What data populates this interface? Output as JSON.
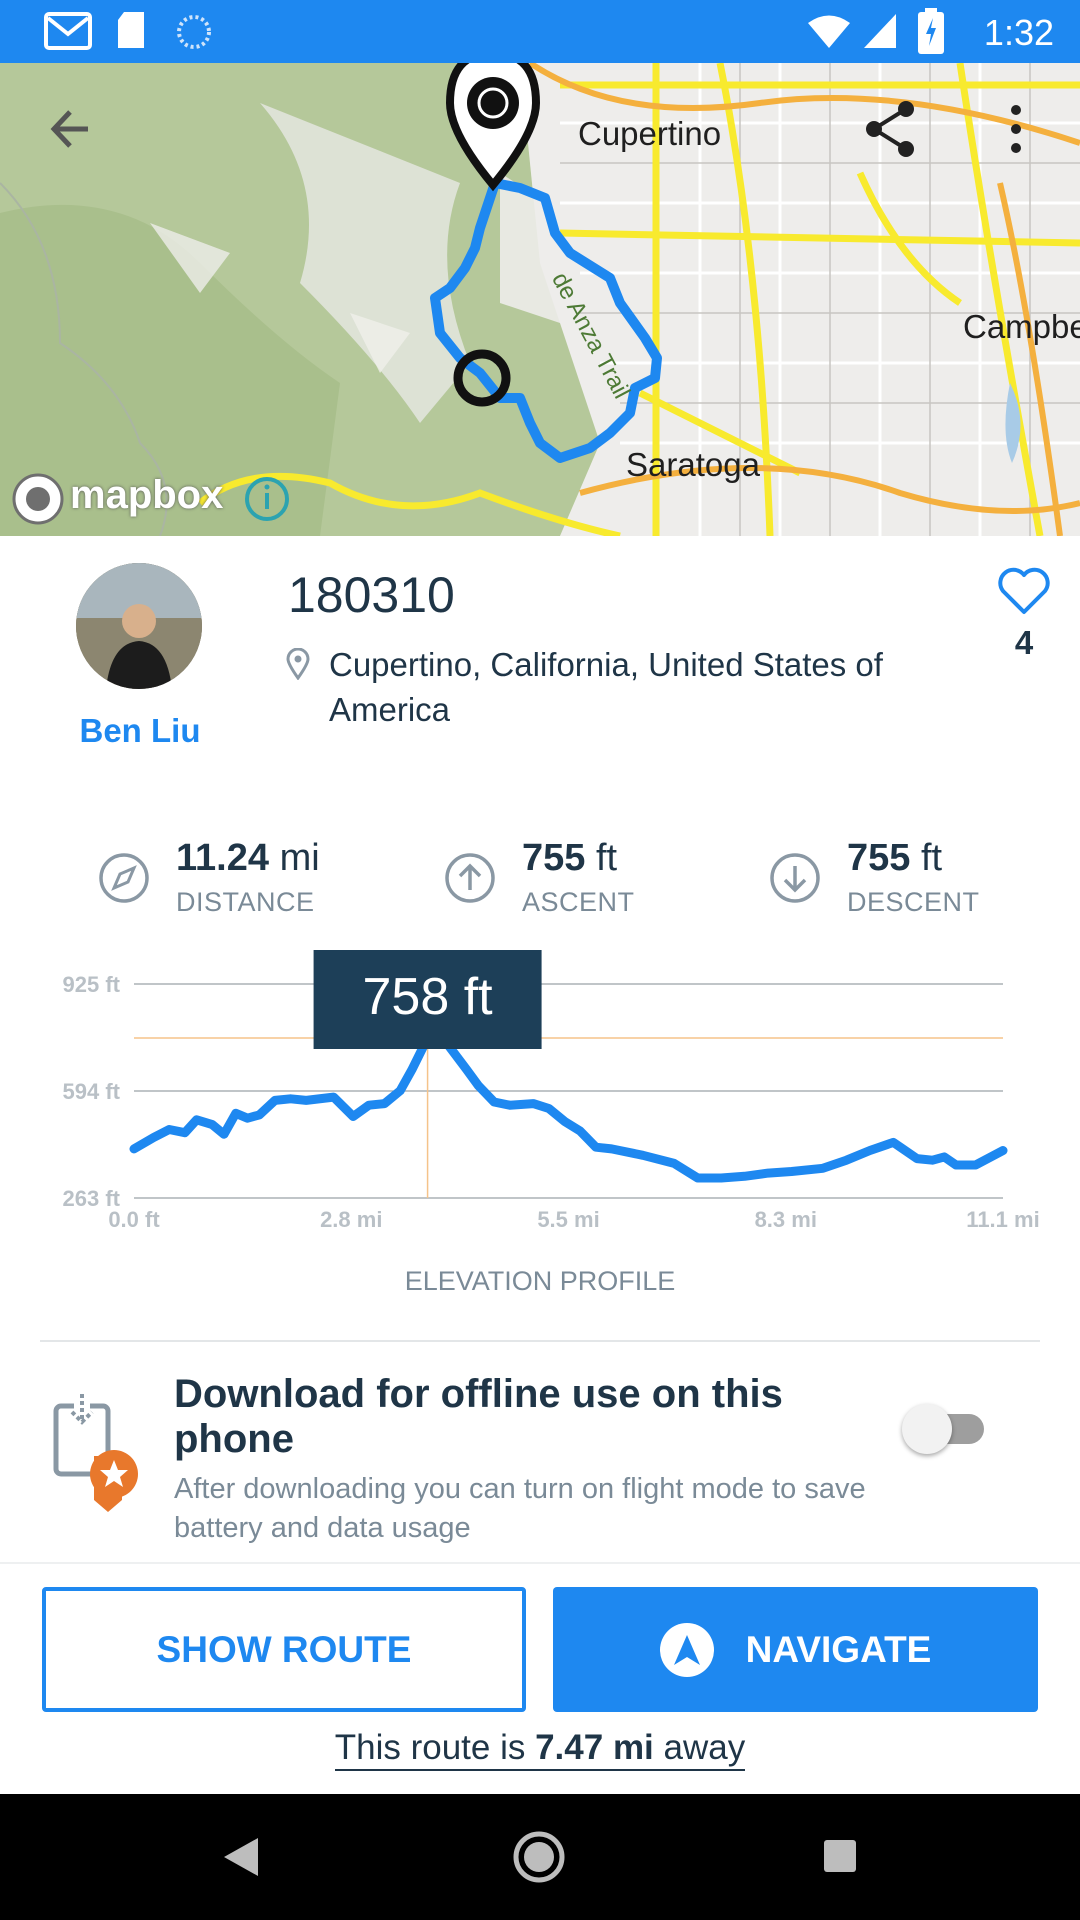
{
  "status_bar": {
    "time": "1:32"
  },
  "map": {
    "labels": {
      "cupertino": "Cupertino",
      "saratoga": "Saratoga",
      "campbell": "Campbe",
      "trail": "de Anza Trail"
    },
    "attribution": "mapbox"
  },
  "route": {
    "title": "180310",
    "location": "Cupertino, California, United States of America",
    "author": "Ben Liu",
    "likes": "4"
  },
  "stats": {
    "distance": {
      "value": "11.24",
      "unit": "mi",
      "label": "DISTANCE"
    },
    "ascent": {
      "value": "755",
      "unit": "ft",
      "label": "ASCENT"
    },
    "descent": {
      "value": "755",
      "unit": "ft",
      "label": "DESCENT"
    }
  },
  "chart_data": {
    "type": "line",
    "title": "ELEVATION PROFILE",
    "y_ticks": [
      "925 ft",
      "594 ft",
      "263 ft"
    ],
    "x_ticks": [
      "0.0 ft",
      "2.8 mi",
      "5.5 mi",
      "8.3 mi",
      "11.1 mi"
    ],
    "ylim": [
      263,
      925
    ],
    "xlim": [
      0,
      11.1
    ],
    "tooltip": "758 ft",
    "tooltip_x": 3.75,
    "series": [
      {
        "values": [
          [
            0.0,
            415
          ],
          [
            0.25,
            450
          ],
          [
            0.45,
            475
          ],
          [
            0.65,
            465
          ],
          [
            0.8,
            505
          ],
          [
            1.0,
            490
          ],
          [
            1.15,
            460
          ],
          [
            1.3,
            525
          ],
          [
            1.45,
            510
          ],
          [
            1.6,
            520
          ],
          [
            1.8,
            565
          ],
          [
            2.0,
            570
          ],
          [
            2.2,
            565
          ],
          [
            2.55,
            575
          ],
          [
            2.8,
            515
          ],
          [
            3.0,
            550
          ],
          [
            3.2,
            555
          ],
          [
            3.4,
            595
          ],
          [
            3.55,
            660
          ],
          [
            3.75,
            758
          ],
          [
            4.0,
            740
          ],
          [
            4.25,
            660
          ],
          [
            4.4,
            610
          ],
          [
            4.6,
            560
          ],
          [
            4.8,
            550
          ],
          [
            5.1,
            555
          ],
          [
            5.3,
            540
          ],
          [
            5.5,
            500
          ],
          [
            5.7,
            470
          ],
          [
            5.9,
            420
          ],
          [
            6.1,
            415
          ],
          [
            6.5,
            395
          ],
          [
            6.9,
            370
          ],
          [
            7.2,
            325
          ],
          [
            7.5,
            325
          ],
          [
            7.8,
            330
          ],
          [
            8.1,
            340
          ],
          [
            8.4,
            345
          ],
          [
            8.8,
            355
          ],
          [
            9.1,
            380
          ],
          [
            9.4,
            410
          ],
          [
            9.7,
            435
          ],
          [
            10.0,
            385
          ],
          [
            10.2,
            380
          ],
          [
            10.35,
            390
          ],
          [
            10.5,
            365
          ],
          [
            10.75,
            365
          ],
          [
            11.1,
            410
          ]
        ]
      }
    ]
  },
  "offline": {
    "title": "Download for offline use on this phone",
    "subtitle": "After downloading you can turn on flight mode to save battery and data usage",
    "enabled": false
  },
  "actions": {
    "show_route": "SHOW ROUTE",
    "navigate": "NAVIGATE",
    "away_prefix": "This route is",
    "away_distance": "7.47 mi",
    "away_suffix": "away"
  },
  "colors": {
    "accent": "#1e88f0",
    "text": "#1f3547",
    "muted": "#7a8a97",
    "tooltip_bg": "#1d3f58",
    "guide": "#f5c38a",
    "badge": "#e8782c"
  }
}
